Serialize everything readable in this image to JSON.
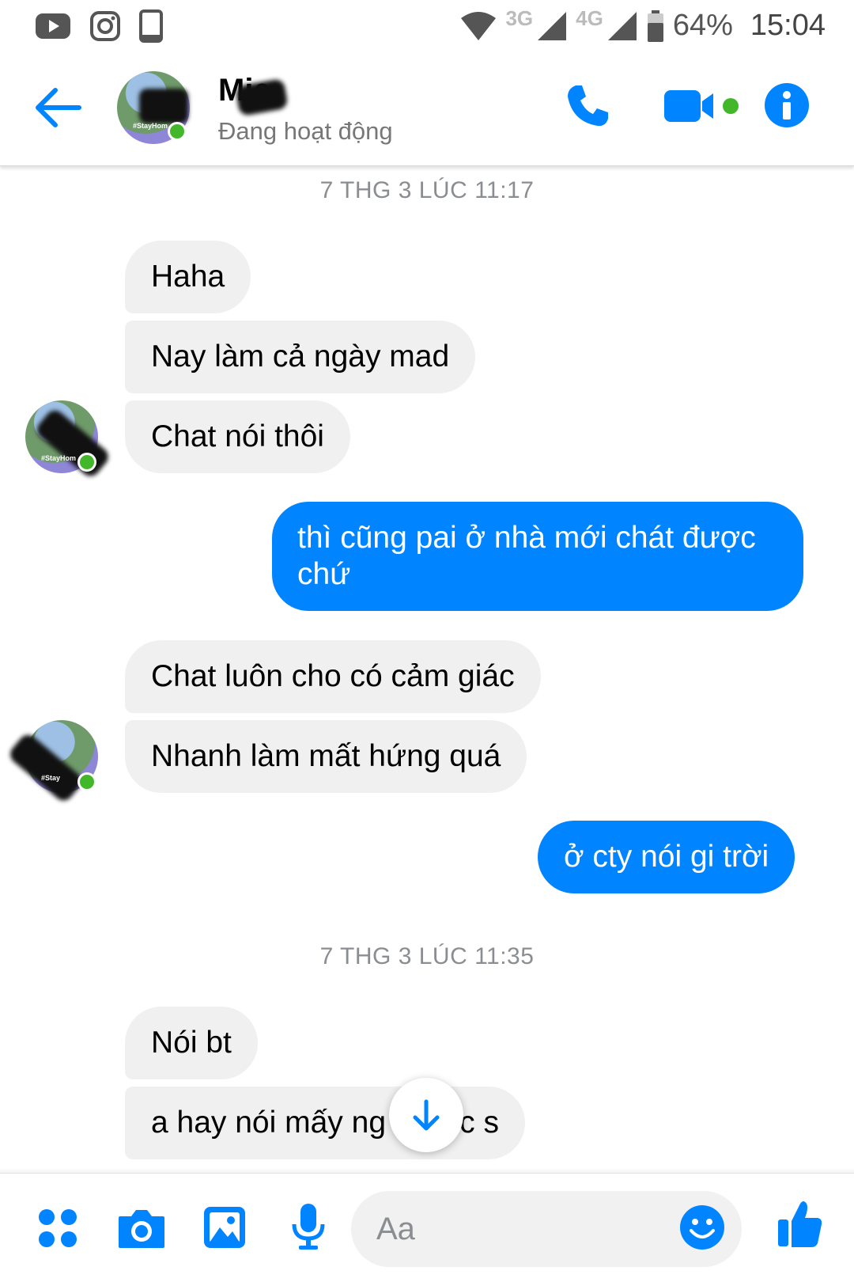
{
  "status_bar": {
    "net1": "3G",
    "net2": "4G",
    "battery": "64%",
    "time": "15:04"
  },
  "header": {
    "contact_name": "Mie",
    "contact_status": "Đang hoạt động"
  },
  "conversation": {
    "timestamp1": "7 THG 3 LÚC 11:17",
    "timestamp2": "7 THG 3 LÚC 11:35",
    "messages": [
      {
        "text": "Haha",
        "side": "incoming"
      },
      {
        "text": "Nay làm cả ngày mad",
        "side": "incoming"
      },
      {
        "text": "Chat nói thôi",
        "side": "incoming"
      },
      {
        "text": "thì cũng pai ở nhà mới chát được chứ",
        "side": "outgoing"
      },
      {
        "text": "Chat luôn cho có cảm giác",
        "side": "incoming"
      },
      {
        "text": "Nhanh làm mất hứng quá",
        "side": "incoming"
      },
      {
        "text": "ở cty nói gi trời",
        "side": "outgoing"
      },
      {
        "text": "Nói bt",
        "side": "incoming"
      },
      {
        "text": "a hay nói mấy ng",
        "side": "incoming"
      },
      {
        "text": "c s",
        "side": "incoming"
      }
    ]
  },
  "composer": {
    "placeholder": "Aa"
  },
  "colors": {
    "accent": "#0084ff",
    "online": "#42b72a",
    "incoming_bubble": "#f0f0f0"
  },
  "icons": [
    "youtube-icon",
    "instagram-icon",
    "phone-icon",
    "wifi-icon",
    "signal-icon",
    "battery-icon",
    "back-arrow-icon",
    "call-icon",
    "video-call-icon",
    "info-icon",
    "scroll-down-arrow-icon",
    "apps-icon",
    "camera-icon",
    "gallery-icon",
    "microphone-icon",
    "emoji-icon",
    "like-icon"
  ]
}
